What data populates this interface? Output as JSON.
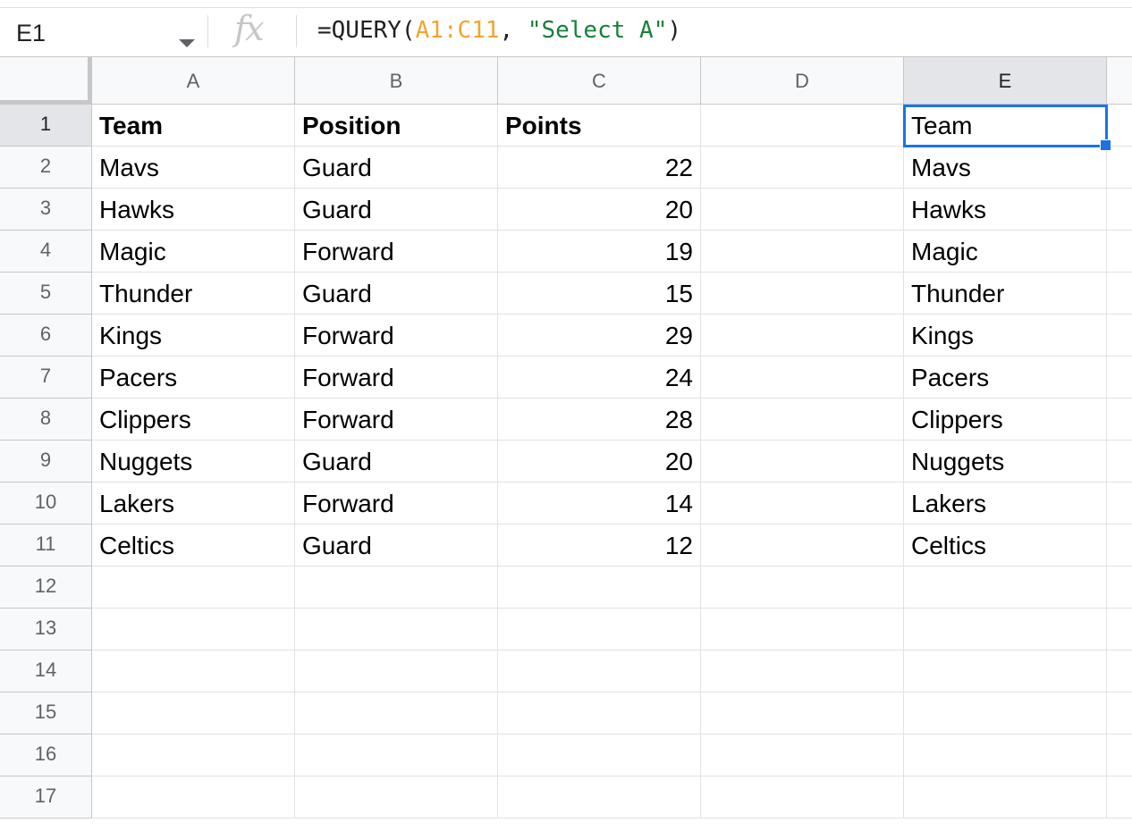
{
  "formula_bar": {
    "cell_ref": "E1",
    "fx_label": "fx",
    "formula_prefix": "=QUERY(",
    "formula_range": "A1:C11",
    "formula_sep": ", ",
    "formula_string": "\"Select A\"",
    "formula_suffix": ")",
    "icons": [
      "dropdown-caret-icon",
      "fx-icon"
    ]
  },
  "grid": {
    "columns": [
      "A",
      "B",
      "C",
      "D",
      "E"
    ],
    "rows": [
      "1",
      "2",
      "3",
      "4",
      "5",
      "6",
      "7",
      "8",
      "9",
      "10",
      "11",
      "12",
      "13",
      "14",
      "15",
      "16",
      "17"
    ],
    "selected_cell": "E1",
    "cells": [
      [
        "Team",
        "Position",
        "Points",
        "",
        "Team"
      ],
      [
        "Mavs",
        "Guard",
        "22",
        "",
        "Mavs"
      ],
      [
        "Hawks",
        "Guard",
        "20",
        "",
        "Hawks"
      ],
      [
        "Magic",
        "Forward",
        "19",
        "",
        "Magic"
      ],
      [
        "Thunder",
        "Guard",
        "15",
        "",
        "Thunder"
      ],
      [
        "Kings",
        "Forward",
        "29",
        "",
        "Kings"
      ],
      [
        "Pacers",
        "Forward",
        "24",
        "",
        "Pacers"
      ],
      [
        "Clippers",
        "Forward",
        "28",
        "",
        "Clippers"
      ],
      [
        "Nuggets",
        "Guard",
        "20",
        "",
        "Nuggets"
      ],
      [
        "Lakers",
        "Forward",
        "14",
        "",
        "Lakers"
      ],
      [
        "Celtics",
        "Guard",
        "12",
        "",
        "Celtics"
      ],
      [
        "",
        "",
        "",
        "",
        ""
      ],
      [
        "",
        "",
        "",
        "",
        ""
      ],
      [
        "",
        "",
        "",
        "",
        ""
      ],
      [
        "",
        "",
        "",
        "",
        ""
      ],
      [
        "",
        "",
        "",
        "",
        ""
      ],
      [
        "",
        "",
        "",
        "",
        ""
      ]
    ]
  },
  "colors": {
    "selection": "#1a73e8",
    "formula_range": "#f4a52c",
    "formula_string": "#188038"
  }
}
